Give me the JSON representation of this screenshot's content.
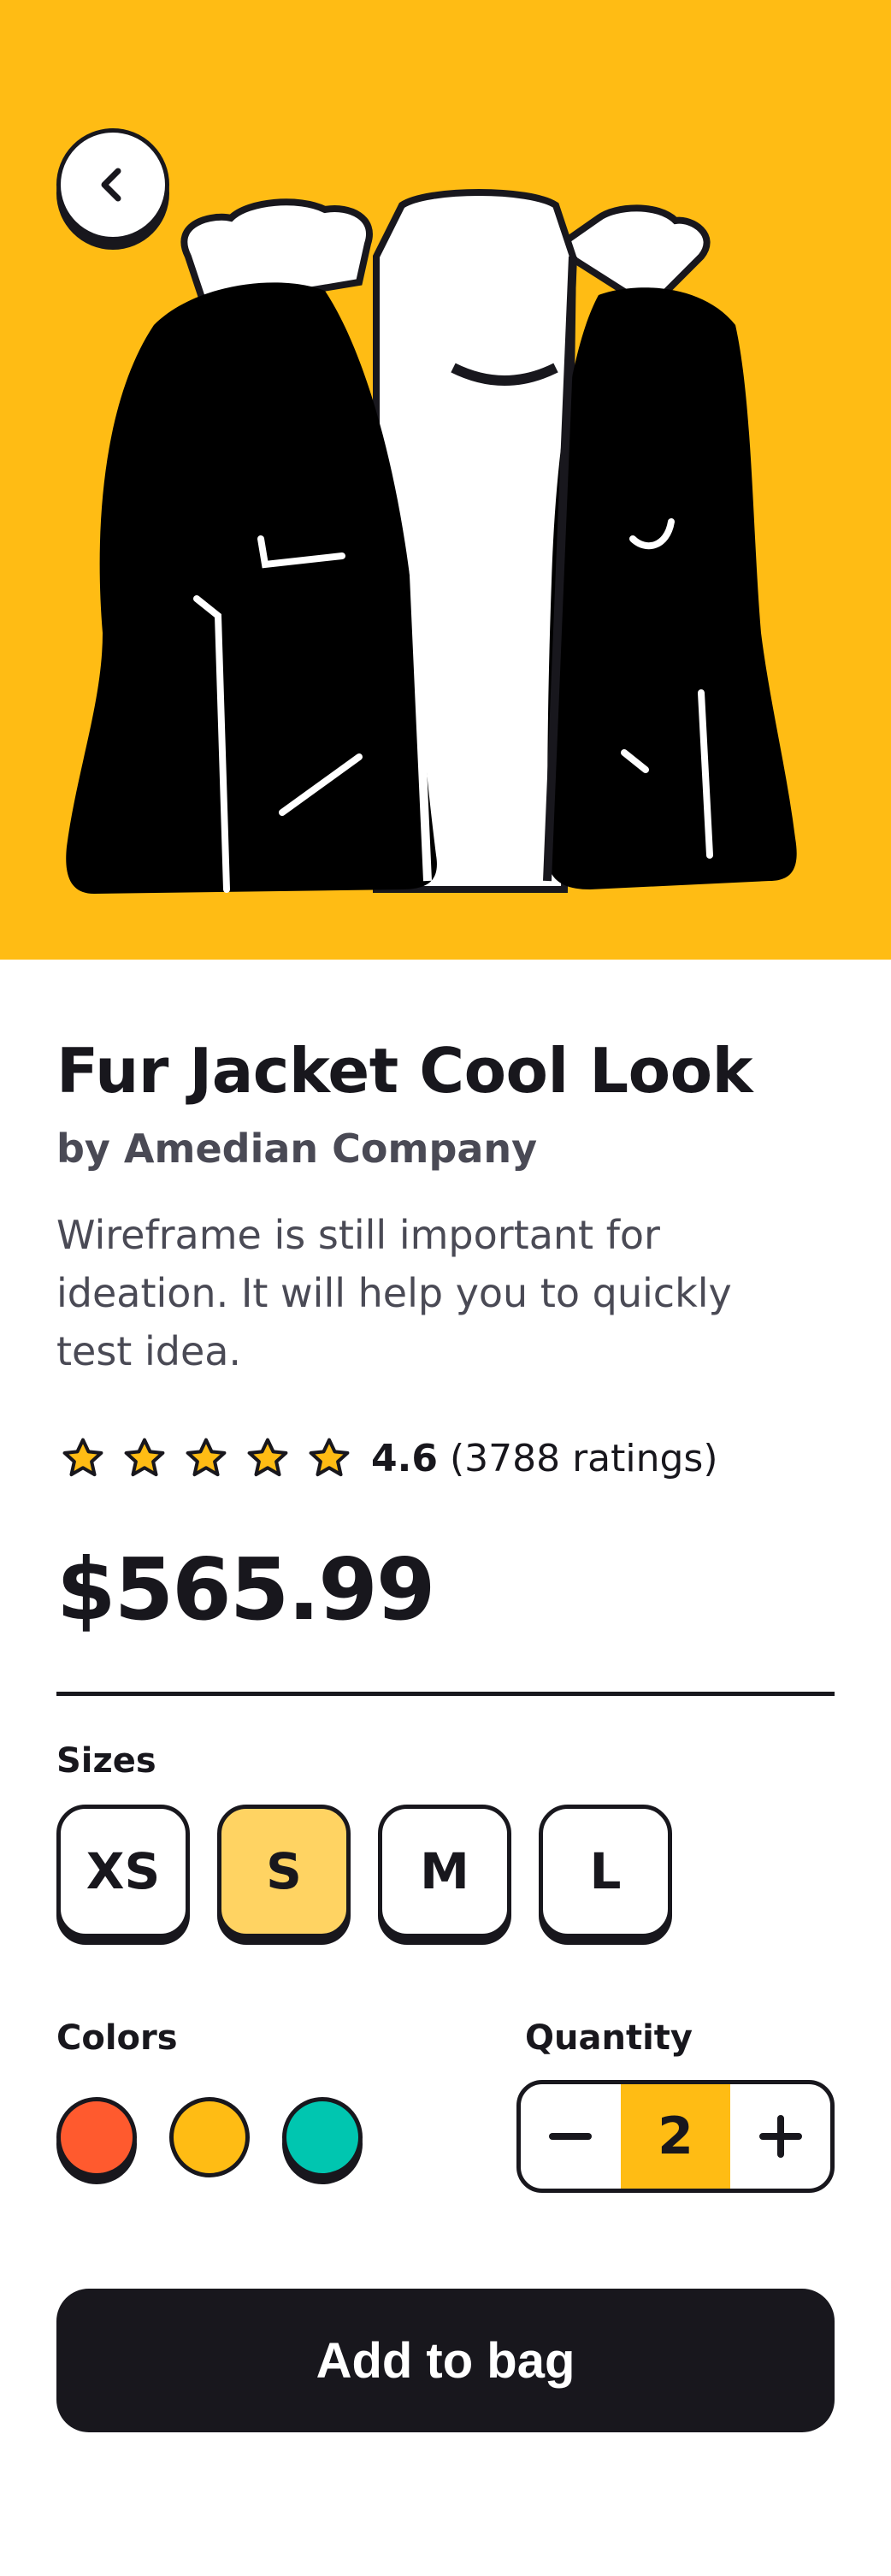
{
  "product": {
    "title": "Fur Jacket Cool Look",
    "vendor": "by Amedian Company",
    "description": "Wireframe is still important for ideation. It will help you to quickly test idea.",
    "price": "$565.99",
    "image": "jacket-illustration"
  },
  "rating": {
    "stars": 5,
    "value": "4.6",
    "count": "(3788 ratings)"
  },
  "sizes": {
    "label": "Sizes",
    "options": [
      "XS",
      "S",
      "M",
      "L"
    ],
    "selected": "S"
  },
  "colors": {
    "label": "Colors",
    "options": [
      "#ff5a2e",
      "#ffbc14",
      "#00c6b0"
    ]
  },
  "quantity": {
    "label": "Quantity",
    "value": "2",
    "decrement_icon": "minus-icon",
    "increment_icon": "plus-icon"
  },
  "actions": {
    "add_to_bag": "Add to bag",
    "back_icon": "chevron-left-icon"
  },
  "theme": {
    "accent": "#ffbc14",
    "selected_size": "#ffd362",
    "dark": "#18171d",
    "muted_text": "#4a4a55"
  }
}
